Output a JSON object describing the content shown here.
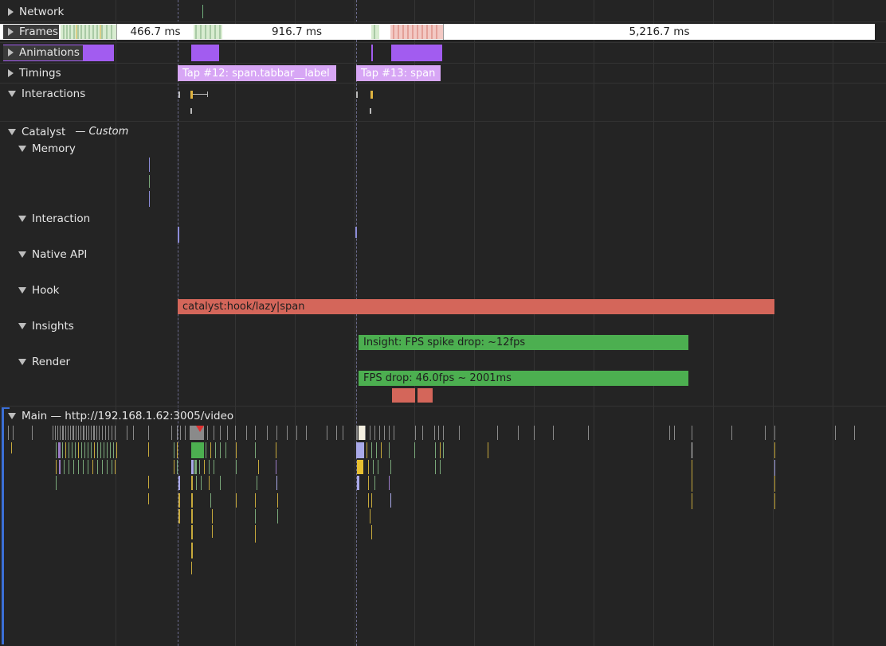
{
  "tracks": {
    "network": "Network",
    "frames": "Frames",
    "animations": "Animations",
    "timings": "Timings",
    "interactions": "Interactions",
    "catalyst": "Catalyst",
    "catalyst_custom": "— Custom",
    "memory": "Memory",
    "interaction": "Interaction",
    "native_api": "Native API",
    "hook": "Hook",
    "insights": "Insights",
    "render": "Render",
    "main": "Main — http://192.168.1.62:3005/video"
  },
  "frames": {
    "f1": "466.7 ms",
    "f2": "916.7 ms",
    "f3": "5,216.7 ms"
  },
  "timings": {
    "tap12": "Tap #12: span.tabbar__label",
    "tap13": "Tap #13: span"
  },
  "hook": {
    "bar": "catalyst:hook/lazy|span"
  },
  "insights": {
    "bar": "Insight: FPS spike drop: ~12fps"
  },
  "render": {
    "bar": "FPS drop: 46.0fps ~ 2001ms"
  },
  "colors": {
    "background": "#242424",
    "animation": "#a25cf0",
    "timing": "#d7a6f5",
    "hook": "#d4665a",
    "insight": "#4caf50",
    "render_block": "#d4665a",
    "main_selected": "#3b6fd6"
  }
}
